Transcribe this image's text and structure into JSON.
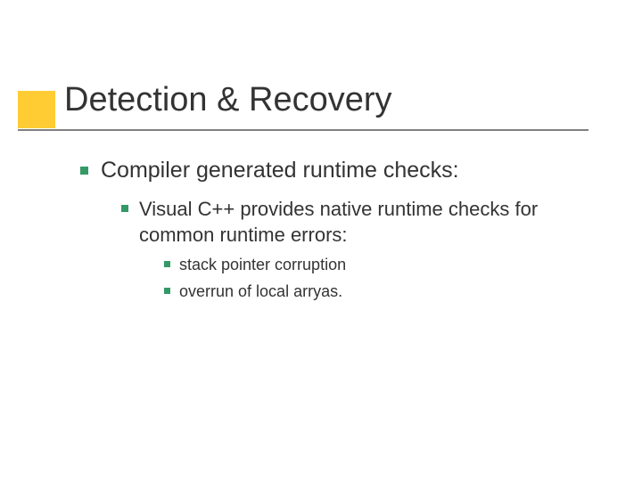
{
  "title": "Detection & Recovery",
  "level1": {
    "text": "Compiler generated runtime checks:"
  },
  "level2": {
    "text": "Visual C++ provides native runtime checks for common runtime errors:"
  },
  "level3": [
    {
      "text": "stack pointer corruption"
    },
    {
      "text": "overrun of local arryas."
    }
  ]
}
